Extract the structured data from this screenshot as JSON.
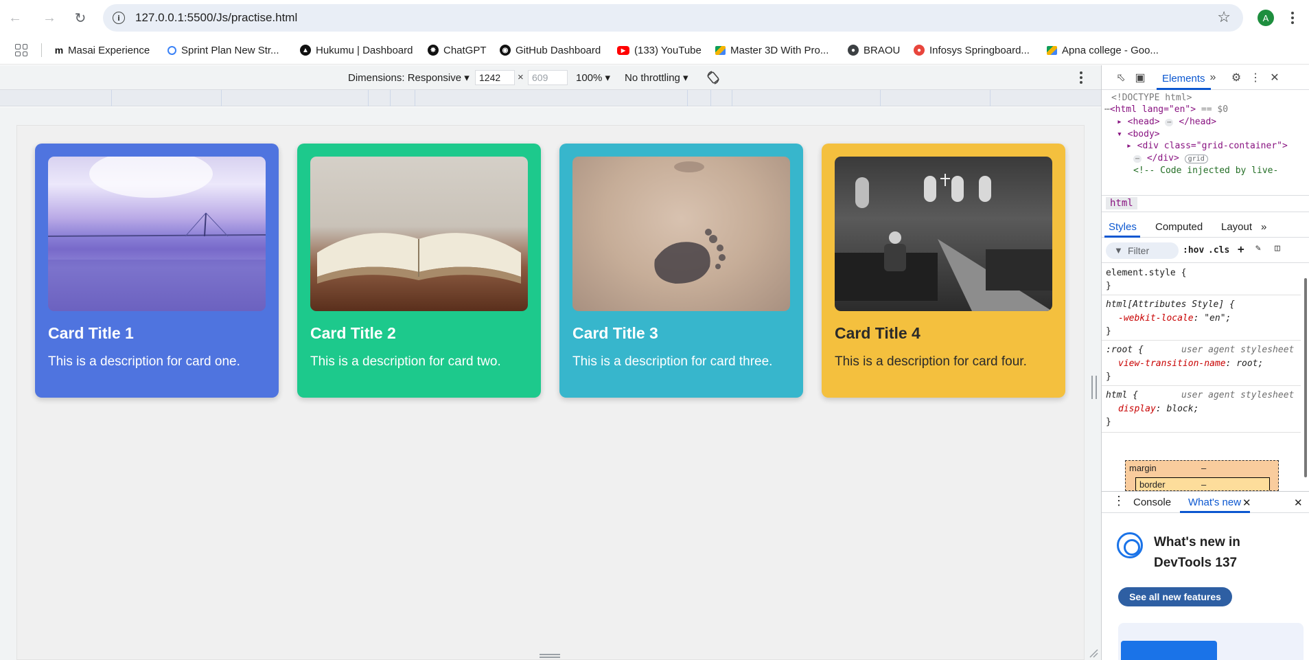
{
  "browser": {
    "url": "127.0.0.1:5500/Js/practise.html",
    "profile_initial": "A",
    "bookmarks": [
      {
        "label": "Masai Experience",
        "icon": "masai-icon"
      },
      {
        "label": "Sprint Plan New Str...",
        "icon": "sprint-icon"
      },
      {
        "label": "Hukumu | Dashboard",
        "icon": "hukumu-icon"
      },
      {
        "label": "ChatGPT",
        "icon": "chatgpt-icon"
      },
      {
        "label": "GitHub Dashboard",
        "icon": "github-icon"
      },
      {
        "label": "(133) YouTube",
        "icon": "youtube-icon"
      },
      {
        "label": "Master 3D With Pro...",
        "icon": "google-drive-icon"
      },
      {
        "label": "BRAOU",
        "icon": "globe-icon"
      },
      {
        "label": "Infosys Springboard...",
        "icon": "infosys-icon"
      },
      {
        "label": "Apna college - Goo...",
        "icon": "google-drive-icon"
      }
    ]
  },
  "device_toolbar": {
    "dimensions_label": "Dimensions: Responsive",
    "width": "1242",
    "height": "609",
    "times": "×",
    "zoom": "100%",
    "throttling": "No throttling"
  },
  "page": {
    "cards": [
      {
        "title": "Card Title 1",
        "description": "This is a description for card one.",
        "color": "#4f74df",
        "image": "sea-bridge"
      },
      {
        "title": "Card Title 2",
        "description": "This is a description for card two.",
        "color": "#1dc98c",
        "image": "open-book"
      },
      {
        "title": "Card Title 3",
        "description": "This is a description for card three.",
        "color": "#37b6cc",
        "image": "footprint-sand"
      },
      {
        "title": "Card Title 4",
        "description": "This is a description for card four.",
        "color": "#f4c03e",
        "image": "church-interior"
      }
    ]
  },
  "devtools": {
    "active_tab": "Elements",
    "dom": {
      "doctype": "<!DOCTYPE html>",
      "html_open": "<html lang=\"en\">",
      "dollar": "== $0",
      "head": "<head>",
      "head_close": "</head>",
      "body": "<body>",
      "div": "<div class=\"grid-container\">",
      "div_close": "</div>",
      "grid_badge": "grid",
      "comment": "<!-- Code injected by live-"
    },
    "breadcrumb": "html",
    "subtabs": [
      "Styles",
      "Computed",
      "Layout"
    ],
    "filter_placeholder": "Filter",
    "hov": ":hov",
    "cls": ".cls",
    "styles": {
      "element_style": "element.style {",
      "close": "}",
      "html_attr": "html[Attributes Style] {",
      "locale_prop": "-webkit-locale",
      "locale_val": ": \"en\";",
      "root_sel": ":root {",
      "ua_label": "user agent stylesheet",
      "vt_prop": "view-transition-name",
      "vt_val": ": root;",
      "html_sel": "html {",
      "display_prop": "display",
      "display_val": ": block;"
    },
    "box_model": {
      "margin": "margin",
      "border": "border",
      "dash": "–"
    },
    "drawer_tabs": [
      "Console",
      "What's new"
    ],
    "whats_new_title": "What's new in DevTools 137",
    "see_all": "See all new features"
  }
}
